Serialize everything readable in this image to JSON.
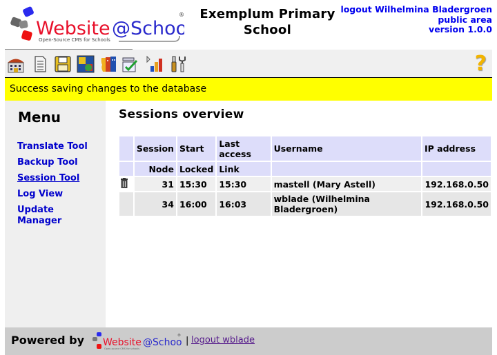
{
  "header": {
    "logo_text": "Website@School",
    "logo_tagline": "Open-Source CMS for Schools",
    "site_title_line1": "Exemplum Primary",
    "site_title_line2": "School",
    "logout_link": "logout Wilhelmina Bladergroen",
    "area_link": "public area",
    "version_link": "version 1.0.0"
  },
  "toolbar": {
    "icons": [
      "home-icon",
      "page-icon",
      "save-disk-icon",
      "modules-puzzle-icon",
      "users-faces-icon",
      "checklist-icon",
      "statistics-bars-icon",
      "tools-icon"
    ],
    "help_icon": "?"
  },
  "message": "Success saving changes to the database",
  "menu": {
    "title": "Menu",
    "items": [
      {
        "label": "Translate Tool",
        "active": false
      },
      {
        "label": "Backup Tool",
        "active": false
      },
      {
        "label": "Session Tool",
        "active": true
      },
      {
        "label": "Log View",
        "active": false
      },
      {
        "label": "Update Manager",
        "active": false
      }
    ]
  },
  "main": {
    "title": "Sessions overview",
    "table": {
      "header1": [
        "",
        "Session",
        "Start",
        "Last access",
        "Username",
        "IP address"
      ],
      "header2": [
        "",
        "Node",
        "Locked",
        "Link",
        "",
        ""
      ],
      "rows": [
        {
          "delete_icon": "trash-icon",
          "session": "31",
          "start": "15:30",
          "last_access": "15:30",
          "username": "mastell (Mary Astell)",
          "ip": "192.168.0.50"
        },
        {
          "delete_icon": "",
          "session": "34",
          "start": "16:00",
          "last_access": "16:03",
          "username": "wblade (Wilhelmina Bladergroen)",
          "ip": "192.168.0.50"
        }
      ]
    }
  },
  "footer": {
    "powered_by": "Powered by",
    "separator": "|",
    "logout_link": "logout wblade"
  },
  "colors": {
    "link": "#0000cc",
    "message_bg": "#ffff00",
    "table_header_bg": "#ddddfa",
    "menu_bg": "#efefef",
    "footer_bg": "#cccccc"
  }
}
